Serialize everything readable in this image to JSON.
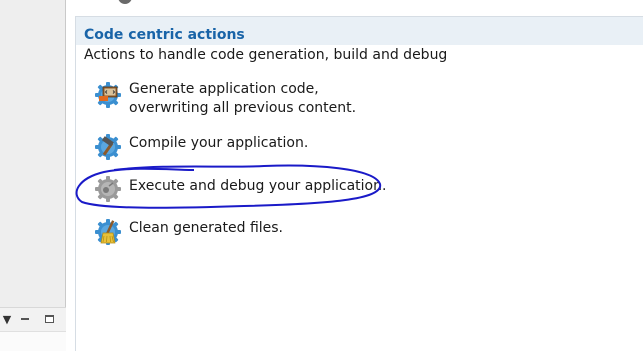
{
  "section": {
    "title": "Code centric actions",
    "description": "Actions to handle code generation, build and debug"
  },
  "actions": [
    {
      "id": "generate",
      "label_line1": "Generate application code,",
      "label_line2": "overwriting all previous content.",
      "icon": "gear-code-icon"
    },
    {
      "id": "compile",
      "label": "Compile your application.",
      "icon": "gear-hammer-icon"
    },
    {
      "id": "execute",
      "label": "Execute and debug your application.",
      "icon": "gear-debug-icon"
    },
    {
      "id": "clean",
      "label": "Clean generated files.",
      "icon": "gear-broom-icon"
    }
  ],
  "colors": {
    "section_title": "#1964a8",
    "section_header_bg": "#e9f0f6",
    "gear_blue": "#3b8fd0",
    "gear_gray": "#9a9a9a",
    "annotation": "#1a1ac8"
  }
}
